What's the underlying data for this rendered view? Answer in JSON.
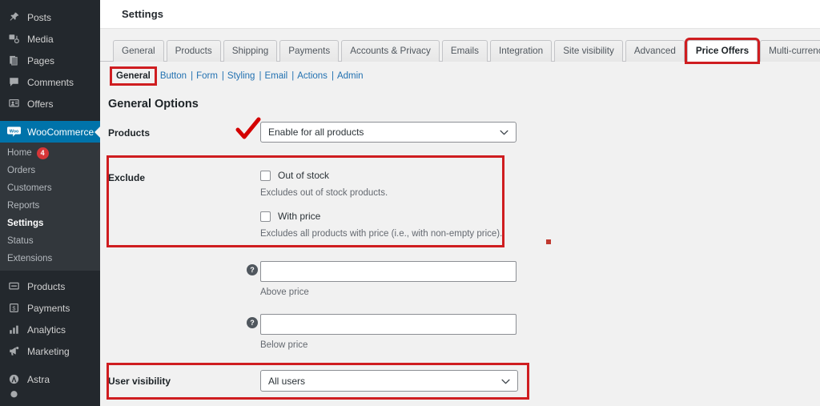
{
  "sidebar": {
    "items": [
      {
        "label": "Posts",
        "icon": "pin-icon"
      },
      {
        "label": "Media",
        "icon": "media-icon"
      },
      {
        "label": "Pages",
        "icon": "pages-icon"
      },
      {
        "label": "Comments",
        "icon": "comment-icon"
      },
      {
        "label": "Offers",
        "icon": "offers-icon"
      },
      {
        "label": "WooCommerce",
        "icon": "woocommerce-icon",
        "current": true
      },
      {
        "label": "Products",
        "icon": "products-icon"
      },
      {
        "label": "Payments",
        "icon": "payments-icon"
      },
      {
        "label": "Analytics",
        "icon": "analytics-icon"
      },
      {
        "label": "Marketing",
        "icon": "marketing-icon"
      },
      {
        "label": "Astra",
        "icon": "astra-icon"
      }
    ],
    "submenu": [
      {
        "label": "Home",
        "badge": "4"
      },
      {
        "label": "Orders"
      },
      {
        "label": "Customers"
      },
      {
        "label": "Reports"
      },
      {
        "label": "Settings",
        "active": true
      },
      {
        "label": "Status"
      },
      {
        "label": "Extensions"
      }
    ]
  },
  "topbar": {
    "title": "Settings"
  },
  "tabs": [
    {
      "label": "General"
    },
    {
      "label": "Products"
    },
    {
      "label": "Shipping"
    },
    {
      "label": "Payments"
    },
    {
      "label": "Accounts & Privacy"
    },
    {
      "label": "Emails"
    },
    {
      "label": "Integration"
    },
    {
      "label": "Site visibility"
    },
    {
      "label": "Advanced"
    },
    {
      "label": "Price Offers",
      "active": true,
      "highlighted": true
    },
    {
      "label": "Multi-currency"
    }
  ],
  "subtabs": [
    {
      "label": "General",
      "current": true,
      "highlighted": true
    },
    {
      "label": "Button"
    },
    {
      "label": "Form"
    },
    {
      "label": "Styling"
    },
    {
      "label": "Email"
    },
    {
      "label": "Actions"
    },
    {
      "label": "Admin"
    }
  ],
  "subtab_separator": "|",
  "section": {
    "title": "General Options"
  },
  "fields": {
    "products": {
      "label": "Products",
      "value": "Enable for all products",
      "options": [
        "Enable for all products"
      ]
    },
    "exclude": {
      "label": "Exclude",
      "out_of_stock": {
        "label": "Out of stock",
        "checked": false,
        "description": "Excludes out of stock products."
      },
      "with_price": {
        "label": "With price",
        "checked": false,
        "description": "Excludes all products with price (i.e., with non-empty price)."
      }
    },
    "above_price": {
      "value": "",
      "description": "Above price",
      "help": "?"
    },
    "below_price": {
      "value": "",
      "description": "Below price",
      "help": "?"
    },
    "user_visibility": {
      "label": "User visibility",
      "value": "All users",
      "options": [
        "All users"
      ]
    }
  },
  "annotations": {
    "highlight_color": "#cf1d20",
    "checkmark_color": "#d40000",
    "marker_color": "#c0392f"
  }
}
